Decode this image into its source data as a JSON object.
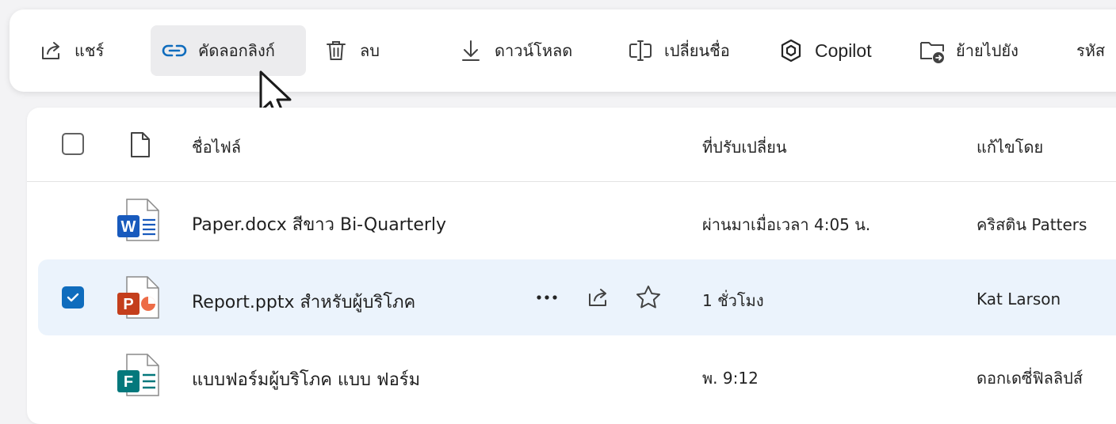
{
  "toolbar": {
    "share": "แชร์",
    "copy_link": "คัดลอกลิงก์",
    "delete": "ลบ",
    "download": "ดาวน์โหลด",
    "rename": "เปลี่ยนชื่อ",
    "copilot": "Copilot",
    "move_to": "ย้ายไปยัง",
    "more": "รหัส"
  },
  "header": {
    "name": "ชื่อไฟล์",
    "modified": "ที่ปรับเปลี่ยน",
    "modified_by": "แก้ไขโดย"
  },
  "files": [
    {
      "name": "Paper.docx สีขาว Bi-Quarterly",
      "modified": "ผ่านมาเมื่อเวลา 4:05 น.",
      "modified_by": "คริสติน   Patters",
      "type": "word",
      "selected": false
    },
    {
      "name": "Report.pptx สำหรับผู้บริโภค",
      "modified": "1 ชั่วโมง",
      "modified_by": "Kat Larson",
      "type": "powerpoint",
      "selected": true
    },
    {
      "name": "แบบฟอร์มผู้บริโภค แบบ ฟอร์ม",
      "modified": "พ. 9:12",
      "modified_by": "ดอกเดซี่ฟิลลิปส์",
      "type": "forms",
      "selected": false
    }
  ],
  "colors": {
    "accent": "#0f6cbd",
    "selected_row": "#ebf3fc",
    "word": "#185abd",
    "powerpoint": "#c43e1c",
    "forms": "#03787c"
  },
  "icons": {
    "share": "share-icon",
    "copy_link": "link-icon",
    "delete": "trash-icon",
    "download": "download-icon",
    "rename": "rename-icon",
    "copilot": "copilot-icon",
    "move_to": "folder-move-icon"
  }
}
